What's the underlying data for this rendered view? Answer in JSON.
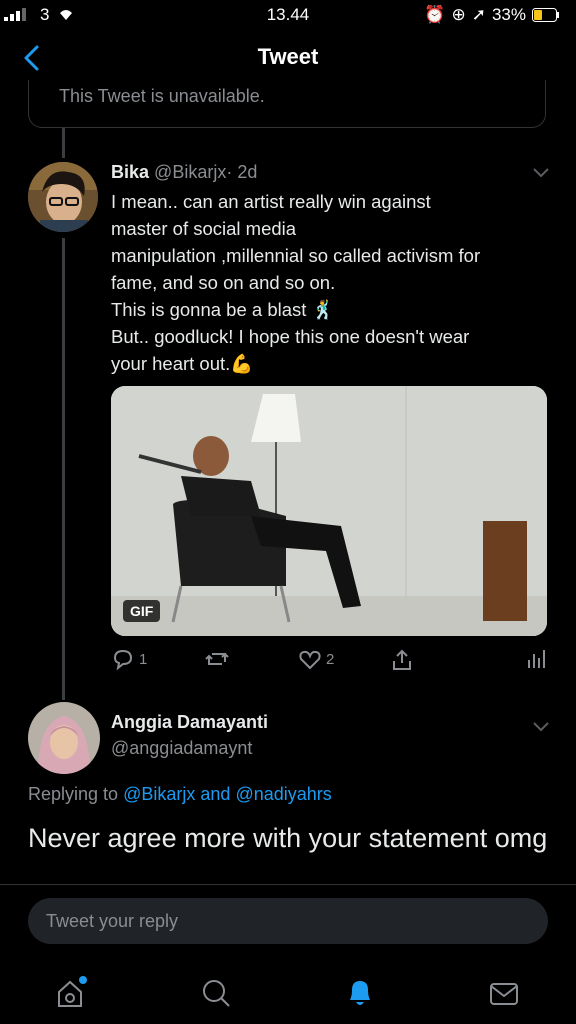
{
  "status": {
    "carrier": "3",
    "time": "13.44",
    "battery": "33%"
  },
  "header": {
    "title": "Tweet"
  },
  "unavailable": {
    "text": "This Tweet is unavailable."
  },
  "tweet": {
    "name": "Bika",
    "handle": "@Bikarjx",
    "sep": "·",
    "time": "2d",
    "lines": [
      "I mean.. can an artist really win against",
      "master of social media",
      "manipulation ,millennial so called activism for",
      "fame, and so on and so on.",
      "This is gonna be a blast 🕺",
      "But.. goodluck! I hope this one doesn't wear",
      "your heart out.💪"
    ],
    "media_badge": "GIF",
    "replies": "1",
    "likes": "2"
  },
  "reply": {
    "name": "Anggia Damayanti",
    "handle": "@anggiadamaynt",
    "replying_prefix": "Replying to",
    "mention1": "@Bikarjx",
    "and": "and",
    "mention2": "@nadiyahrs",
    "text": "Never agree more with your statement omg"
  },
  "composer": {
    "placeholder": "Tweet your reply"
  },
  "tabs": [
    "home-icon",
    "search-icon",
    "notifications-icon",
    "messages-icon"
  ],
  "colors": {
    "accent": "#1d9bf0",
    "background": "#000000",
    "muted": "#8a8d91"
  }
}
